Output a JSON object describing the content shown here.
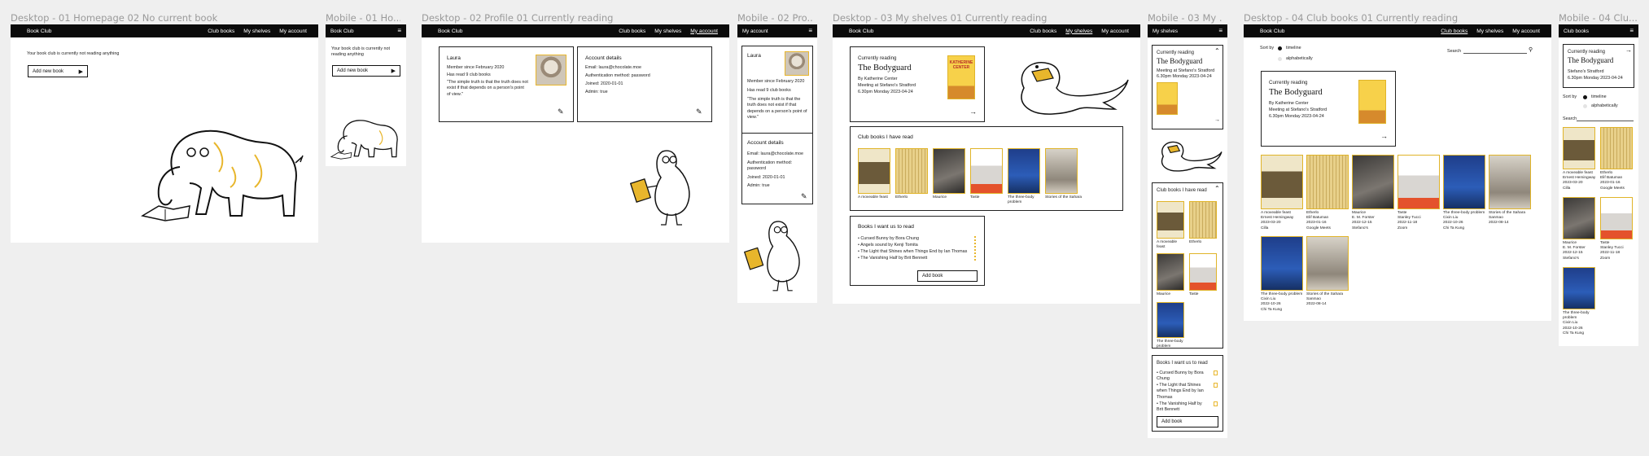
{
  "app": {
    "brand": "Book Club",
    "nav": [
      "Club books",
      "My shelves",
      "My account"
    ],
    "mobile_menu": "≡"
  },
  "frames": {
    "f1": "Desktop - 01 Homepage 02 No current book",
    "f2": "Mobile - 01 Ho...",
    "f3": "Desktop - 02 Profile 01 Currently reading",
    "f4": "Mobile - 02 Pro...",
    "f5": "Desktop - 03 My shelves 01 Currently reading",
    "f6": "Mobile - 03 My ...",
    "f7": "Desktop - 04 Club books 01 Currently reading",
    "f8": "Mobile - 04 Clu..."
  },
  "home": {
    "message": "Your book club is currently not reading anything",
    "add_new_book": "Add new book"
  },
  "mhome": {
    "message": "Your book club is currently not reading anything",
    "add_new_book": "Add new book"
  },
  "profile": {
    "name": "Laura",
    "member_since": "Member since February 2020",
    "books_read": "Has read 9 club books",
    "quote": "\"The simple truth is that the truth does not exist if that depends on a person's point of view.\"",
    "account_title": "Account details",
    "email": "Email: laura@chocolate.moe",
    "auth": "Authentication method: password",
    "joined": "Joined: 2020-01-01",
    "admin": "Admin: true"
  },
  "mprofile": {
    "title": "My account",
    "name": "Laura",
    "member_since": "Member since February 2020",
    "books_read": "Has read 9 club books",
    "quote": "\"The simple truth is that the truth does not exist if that depends on a person's point of view.\"",
    "account_title": "Account details",
    "email": "Email: laura@chocolate.moe",
    "auth": "Authentication method: password",
    "joined": "Joined: 2020-01-01",
    "admin": "Admin: true"
  },
  "shelves": {
    "currently_reading": "Currently reading",
    "book_title": "The Bodyguard",
    "author": "By Katherine Center",
    "meeting": "Meeting at Stefano's Stratford",
    "date": "6.30pm Monday 2023-04-24",
    "cover_text": "KATHERINE CENTER",
    "club_books_title": "Club books I have read",
    "club_books": [
      "A moveable feast",
      "Etherlo",
      "Maurice",
      "Taste",
      "The three-body problem",
      "Stories of the Sahara"
    ],
    "want_title": "Books I want us to read",
    "want_list": [
      "Cursed Bunny by Bora Chung",
      "Angels sound by Kenji Tomita",
      "The Light that Shines when Things End by Ian Thomas",
      "The Vanishing Half by Brit Bennett"
    ],
    "add_book": "Add book"
  },
  "mshelves": {
    "title": "My shelves",
    "currently_reading": "Currently reading",
    "book_title": "The Bodyguard",
    "meeting": "Meeting at Stefano's Stratford",
    "date": "6.30pm Monday 2023-04-24",
    "club_books_title": "Club books I have read",
    "club_books": [
      "A moveable feast",
      "Etherlo",
      "Maurice",
      "Taste",
      "The three-body problem"
    ],
    "want_title": "Books I want us to read",
    "want_list": [
      "Cursed Bunny by Bora Chung",
      "The Light that Shines when Things End by Ian Thomas",
      "The Vanishing Half by Brit Bennett"
    ],
    "add_book": "Add book"
  },
  "clubbooks": {
    "sort_by": "Sort by",
    "sort_options": [
      "timeline",
      "alphabetically"
    ],
    "search_label": "Search",
    "currently_reading": "Currently reading",
    "book_title": "The Bodyguard",
    "author": "By Katherine Center",
    "meeting": "Meeting at Stefano's Stratford",
    "date": "6.30pm Monday 2023-04-24",
    "books": [
      {
        "title": "A moveable feast",
        "author": "Ernest Hemingway",
        "date": "2023-03-20",
        "host": "Cilla"
      },
      {
        "title": "Etherlo",
        "author": "Elif Batuman",
        "date": "2023-01-16",
        "host": "Google Meets"
      },
      {
        "title": "Maurice",
        "author": "E. M. Forster",
        "date": "2022-12-15",
        "host": "Stefano's"
      },
      {
        "title": "Taste",
        "author": "Stanley Tucci",
        "date": "2022-11-18",
        "host": "Zoom"
      },
      {
        "title": "The three-body problem",
        "author": "Cixin Liu",
        "date": "2022-10-26",
        "host": "Chi Ta Kung"
      },
      {
        "title": "Stories of the Sahara",
        "author": "Sanmao",
        "date": "2022-08-14",
        "host": ""
      },
      {
        "title": "The three-body problem",
        "author": "Cixin Liu",
        "date": "2022-10-26",
        "host": "Chi Ta Kung"
      },
      {
        "title": "Stories of the Sahara",
        "author": "Sanmao",
        "date": "2022-08-14",
        "host": ""
      }
    ]
  },
  "mclubbooks": {
    "title": "Club books",
    "currently_reading": "Currently reading",
    "book_title": "The Bodyguard",
    "meeting": "Stefano's Stratford",
    "date": "6.30pm Monday 2023-04-24",
    "sort_by": "Sort by",
    "sort_options": [
      "timeline",
      "alphabetically"
    ],
    "search_label": "Search",
    "books": [
      {
        "title": "A moveable feast",
        "author": "Ernest Hemingway",
        "date": "2023-03-20",
        "host": "Cilla"
      },
      {
        "title": "Etherlo",
        "author": "Elif Batuman",
        "date": "2023-01-16",
        "host": "Google Meets"
      },
      {
        "title": "Maurice",
        "author": "E. M. Forster",
        "date": "2022-12-15",
        "host": "Stefano's"
      },
      {
        "title": "Taste",
        "author": "Stanley Tucci",
        "date": "2022-11-18",
        "host": "Zoom"
      },
      {
        "title": "The three-body problem",
        "author": "Cixin Liu",
        "date": "2022-10-26",
        "host": "Chi Ta Kung"
      }
    ]
  },
  "colors": {
    "accent": "#e8b62c",
    "topbar": "#0b0b0b",
    "canvas": "#efefef"
  },
  "icons": {
    "arrow": "arrow-right-icon",
    "pen": "pencil-icon",
    "trash": "trash-icon",
    "chev": "chevron-up-icon",
    "search": "search-icon",
    "menu": "hamburger-icon"
  }
}
